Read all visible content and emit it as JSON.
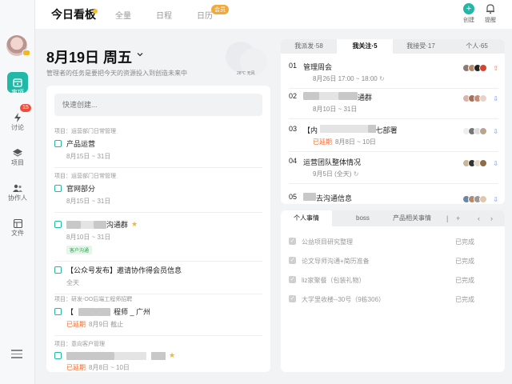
{
  "topbar": {
    "tabs": [
      {
        "label": "今日看板",
        "active": true
      },
      {
        "label": "全量"
      },
      {
        "label": "日程"
      },
      {
        "label": "日历"
      }
    ],
    "vip_badge": "会员",
    "create_label": "创建",
    "remind_label": "提醒"
  },
  "sidebar": {
    "items": [
      {
        "label": "事项",
        "icon": "calendar-icon",
        "active": true
      },
      {
        "label": "讨论",
        "icon": "bolt-icon",
        "badge": "15"
      },
      {
        "label": "项目",
        "icon": "layers-icon"
      },
      {
        "label": "协作人",
        "icon": "people-icon"
      },
      {
        "label": "文件",
        "icon": "file-icon"
      }
    ]
  },
  "day": {
    "title": "8月19日 周五",
    "subtitle": "管理者的任务是要把今天的资源投入到创造未来中",
    "weather": "28℃ 无风"
  },
  "tasks": {
    "quick_placeholder": "快速创建...",
    "items": [
      {
        "project": "项目：运营部门日常管理",
        "name": "产品运营",
        "meta": "8月15日 ~ 31日"
      },
      {
        "project": "项目：运营部门日常管理",
        "name": "官网部分",
        "meta": "8月15日 ~ 31日"
      },
      {
        "name_suffix": "沟通群",
        "meta": "8月10日 ~ 31日",
        "tag": "客户沟通",
        "star": true
      },
      {
        "name": "【公众号发布】邀请协作得会员信息",
        "meta": "全天"
      },
      {
        "project": "项目：研发-OO后端工程师招聘",
        "name_prefix": "【",
        "name_suffix": "程师 _ 广州",
        "late": "已延期",
        "meta": "8月9日 截止"
      },
      {
        "project": "项目：意向客户管理",
        "late": "已延期",
        "meta": "8月8日 ~ 10日",
        "star": true
      }
    ]
  },
  "right_panel": {
    "tabs": [
      {
        "label": "我派发·58"
      },
      {
        "label": "我关注·5",
        "active": true
      },
      {
        "label": "我接受·17"
      },
      {
        "label": "个人·65"
      }
    ],
    "items": [
      {
        "num": "01",
        "title": "管理周会",
        "time": "8月26日 17:00 ~ 18:00",
        "arrow": "up"
      },
      {
        "num": "02",
        "title_suffix": "通群",
        "time": "8月10日 ~ 31日",
        "arrow": "down"
      },
      {
        "num": "03",
        "title_prefix": "【内",
        "title_suffix": "七部署",
        "late": "已延期",
        "time": "8月8日 ~ 10日",
        "arrow": "down"
      },
      {
        "num": "04",
        "title": "运营团队整体情况",
        "time": "9月5日 (全天)",
        "arrow": "down"
      },
      {
        "num": "05",
        "title_suffix": "去沟通信息",
        "arrow": "down"
      }
    ]
  },
  "bottom_panel": {
    "tabs": [
      {
        "label": "个人事情",
        "active": true
      },
      {
        "label": "boss"
      },
      {
        "label": "产品相关事情"
      }
    ],
    "items": [
      {
        "title": "公益项目研究整理",
        "status": "已完成"
      },
      {
        "title": "论文导师沟通+简历准备",
        "status": "已完成"
      },
      {
        "title": "liz家聚餐（包装礼物）",
        "status": "已完成"
      },
      {
        "title": "大学里收楼--30号（9栋306）",
        "status": "已完成"
      }
    ]
  },
  "colors": {
    "accent": "#21b8a8",
    "late": "#f26b30",
    "badge": "#f04b3b"
  }
}
